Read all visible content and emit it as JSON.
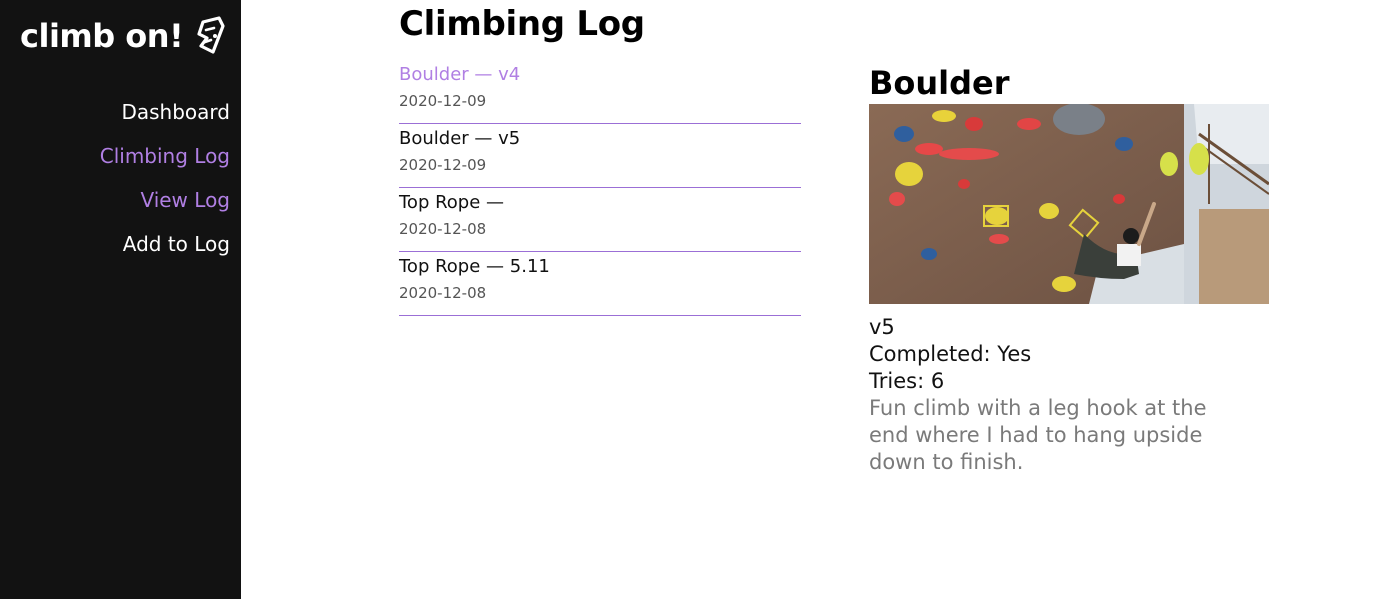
{
  "app": {
    "logo_text": "climb on!",
    "logo_icon": "climbing-hold-icon"
  },
  "nav": {
    "items": [
      {
        "label": "Dashboard",
        "state": "default"
      },
      {
        "label": "Climbing Log",
        "state": "active"
      },
      {
        "label": "View Log",
        "state": "highlight"
      },
      {
        "label": "Add to Log",
        "state": "default"
      }
    ]
  },
  "main": {
    "title": "Climbing Log",
    "entries": [
      {
        "type": "Boulder",
        "separator": "—",
        "grade": "v4",
        "date": "2020-12-09",
        "selected": true
      },
      {
        "type": "Boulder",
        "separator": "—",
        "grade": "v5",
        "date": "2020-12-09",
        "selected": false
      },
      {
        "type": "Top Rope",
        "separator": "—",
        "grade": "",
        "date": "2020-12-08",
        "selected": false
      },
      {
        "type": "Top Rope",
        "separator": "—",
        "grade": "5.11",
        "date": "2020-12-08",
        "selected": false
      }
    ]
  },
  "detail": {
    "title": "Boulder",
    "photo": "bouldering-wall-photo",
    "grade": "v5",
    "completed": "Completed: Yes",
    "tries": "Tries: 6",
    "notes": "Fun climb with a leg hook at the end where I had to hang upside down to finish."
  },
  "colors": {
    "sidebar_bg": "#121212",
    "accent": "#b07fe3",
    "divider": "#9b6fd6",
    "muted_text": "#7a7a7a"
  }
}
